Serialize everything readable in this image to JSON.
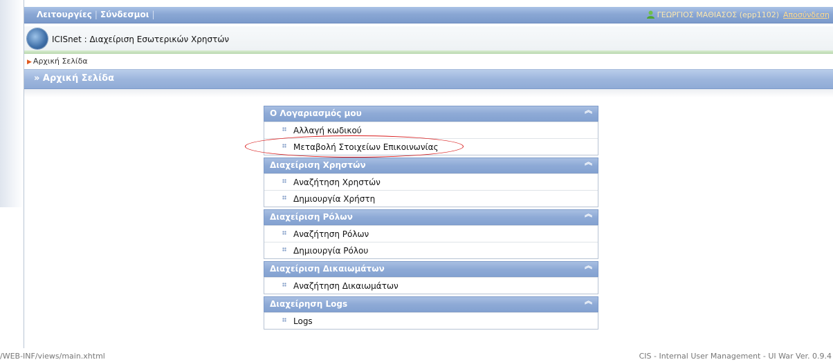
{
  "topbar": {
    "menu_functions": "Λειτουργίες",
    "menu_links": "Σύνδεσμοι",
    "user": "ΓΕΩΡΓΙΟΣ ΜΑΘΙΑΣΟΣ (epp1102)",
    "logout": "Αποσύνδεση"
  },
  "app": {
    "title": "ICISnet : Διαχείριση Εσωτερικών Χρηστών"
  },
  "breadcrumb": {
    "home": "Αρχική Σελίδα"
  },
  "page": {
    "title": "» Αρχική Σελίδα"
  },
  "groups": [
    {
      "title": "Ο Λογαριασμός μου",
      "items": [
        "Αλλαγή κωδικού",
        "Μεταβολή Στοιχείων Επικοινωνίας"
      ]
    },
    {
      "title": "Διαχείριση Χρηστών",
      "items": [
        "Αναζήτηση Χρηστών",
        "Δημιουργία Χρήστη"
      ]
    },
    {
      "title": "Διαχείριση Ρόλων",
      "items": [
        "Αναζήτηση Ρόλων",
        "Δημιουργία Ρόλου"
      ]
    },
    {
      "title": "Διαχείριση Δικαιωμάτων",
      "items": [
        "Αναζήτηση Δικαιωμάτων"
      ]
    },
    {
      "title": "Διαχείρηση Logs",
      "items": [
        "Logs"
      ]
    }
  ],
  "footer": {
    "path": "/WEB-INF/views/main.xhtml",
    "version": "CIS - Internal User Management - UI War Ver. 0.9.4"
  },
  "icons": {
    "collapse": "double-chevron-up-icon",
    "bullet": "grid-dots-icon",
    "user": "user-icon",
    "logo": "globe-logo-icon"
  },
  "colors": {
    "header_blue": "#8aa7d4",
    "highlight_red": "#d81818",
    "user_text": "#fbe7b0"
  }
}
